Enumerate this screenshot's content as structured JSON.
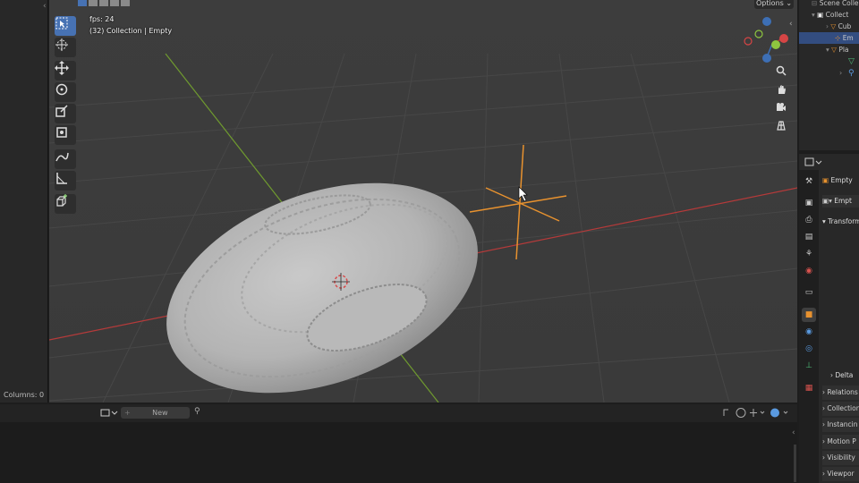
{
  "viewport": {
    "fps_label": "fps: 24",
    "object_info": "(32) Collection | Empty"
  },
  "header": {
    "options_label": "Options",
    "options_chevron": "⌄"
  },
  "left_panel": {
    "status": "Columns: 0"
  },
  "outliner": {
    "rows": [
      {
        "label": "Scene Colle"
      },
      {
        "label": "Collect"
      },
      {
        "label": "Cub"
      },
      {
        "label": "Em"
      },
      {
        "label": "Pla"
      }
    ]
  },
  "properties": {
    "object_name": "Empty",
    "data_name": "Empt",
    "transform_label": "Transform",
    "delta_label": "Delta",
    "panels": [
      "Relations",
      "Collection",
      "Instancin",
      "Motion P",
      "Visibility",
      "Viewpor"
    ]
  },
  "bottom": {
    "new_label": "New"
  },
  "colors": {
    "selection": "#4772b3",
    "empty_orange": "#e8922f",
    "x_axis": "#b53a3a",
    "y_axis": "#7aa33a"
  },
  "icons": [
    "select-box-icon",
    "cursor-icon",
    "move-icon",
    "rotate-icon",
    "scale-icon",
    "transform-icon",
    "annotate-icon",
    "measure-icon",
    "add-cube-icon",
    "zoom-icon",
    "hand-icon",
    "camera-icon",
    "grid-icon",
    "pin-icon"
  ]
}
